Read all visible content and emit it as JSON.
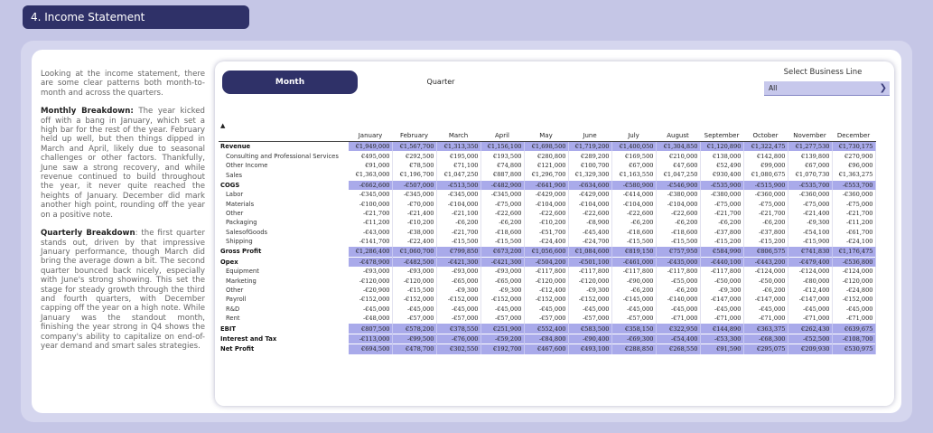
{
  "section_title": "4. Income Statement",
  "narrative": {
    "intro": "Looking at the income statement, there are some clear patterns both month-to-month and across the quarters.",
    "monthly_heading": "Monthly Breakdown:",
    "monthly_text": "The year kicked off with a bang in January, which set a high bar for the rest of the year. February held up well, but then things dipped in March and April, likely due to seasonal challenges or other factors. Thankfully, June saw a strong recovery, and while revenue continued to build throughout the year, it never quite reached the heights of January. December did mark another high point, rounding off the year on a positive note.",
    "quarterly_heading": "Quarterly Breakdown",
    "quarterly_text": ": the first quarter stands out, driven by that impressive January performance, though March did bring the average down a bit. The second quarter bounced back nicely, especially with June's strong showing. This set the stage for steady growth through the third and fourth quarters, with December capping off the year on a high note. While January was the standout month, finishing the year strong in Q4 shows the company's ability to capitalize on end-of-year demand and smart sales strategies."
  },
  "view_toggle": {
    "month_label": "Month",
    "quarter_label": "Quarter",
    "selected": "Month"
  },
  "business_line_filter": {
    "label": "Select Business Line",
    "value": "All"
  },
  "sort_indicator": "▲",
  "table": {
    "columns": [
      "January",
      "February",
      "March",
      "April",
      "May",
      "June",
      "July",
      "August",
      "September",
      "October",
      "November",
      "December"
    ],
    "rows": [
      {
        "label": "Revenue",
        "type": "group",
        "values": [
          "€1,949,000",
          "€1,567,700",
          "€1,313,350",
          "€1,156,100",
          "€1,698,500",
          "€1,719,200",
          "€1,400,050",
          "€1,304,850",
          "€1,120,890",
          "€1,322,475",
          "€1,277,530",
          "€1,730,175"
        ]
      },
      {
        "label": "Consulting and Professional Services",
        "type": "sub",
        "values": [
          "€495,000",
          "€292,500",
          "€195,000",
          "€193,500",
          "€280,800",
          "€289,200",
          "€169,500",
          "€210,000",
          "€138,000",
          "€142,800",
          "€139,800",
          "€270,900"
        ]
      },
      {
        "label": "Other Income",
        "type": "sub",
        "values": [
          "€91,000",
          "€78,500",
          "€71,100",
          "€74,800",
          "€121,000",
          "€100,700",
          "€67,000",
          "€47,600",
          "€52,490",
          "€99,000",
          "€67,000",
          "€96,000"
        ]
      },
      {
        "label": "Sales",
        "type": "sub",
        "values": [
          "€1,363,000",
          "€1,196,700",
          "€1,047,250",
          "€887,800",
          "€1,296,700",
          "€1,329,300",
          "€1,163,550",
          "€1,047,250",
          "€930,400",
          "€1,080,675",
          "€1,070,730",
          "€1,363,275"
        ]
      },
      {
        "label": "COGS",
        "type": "group",
        "values": [
          "-€662,600",
          "-€507,000",
          "-€513,500",
          "-€482,900",
          "-€641,900",
          "-€634,600",
          "-€580,900",
          "-€546,900",
          "-€535,900",
          "-€515,900",
          "-€535,700",
          "-€553,700"
        ]
      },
      {
        "label": "Labor",
        "type": "sub",
        "values": [
          "-€345,000",
          "-€345,000",
          "-€345,000",
          "-€345,000",
          "-€429,000",
          "-€429,000",
          "-€414,000",
          "-€380,000",
          "-€380,000",
          "-€360,000",
          "-€360,000",
          "-€360,000"
        ]
      },
      {
        "label": "Materials",
        "type": "sub",
        "values": [
          "-€100,000",
          "-€70,000",
          "-€104,000",
          "-€75,000",
          "-€104,000",
          "-€104,000",
          "-€104,000",
          "-€104,000",
          "-€75,000",
          "-€75,000",
          "-€75,000",
          "-€75,000"
        ]
      },
      {
        "label": "Other",
        "type": "sub",
        "values": [
          "-€21,700",
          "-€21,400",
          "-€21,100",
          "-€22,600",
          "-€22,600",
          "-€22,600",
          "-€22,600",
          "-€22,600",
          "-€21,700",
          "-€21,700",
          "-€21,400",
          "-€21,700"
        ]
      },
      {
        "label": "Packaging",
        "type": "sub",
        "values": [
          "-€11,200",
          "-€10,200",
          "-€6,200",
          "-€6,200",
          "-€10,200",
          "-€8,900",
          "-€6,200",
          "-€6,200",
          "-€6,200",
          "-€6,200",
          "-€9,300",
          "-€11,200"
        ]
      },
      {
        "label": "SalesofGoods",
        "type": "sub",
        "values": [
          "-€43,000",
          "-€38,000",
          "-€21,700",
          "-€18,600",
          "-€51,700",
          "-€45,400",
          "-€18,600",
          "-€18,600",
          "-€37,800",
          "-€37,800",
          "-€54,100",
          "-€61,700"
        ]
      },
      {
        "label": "Shipping",
        "type": "sub",
        "values": [
          "-€141,700",
          "-€22,400",
          "-€15,500",
          "-€15,500",
          "-€24,400",
          "-€24,700",
          "-€15,500",
          "-€15,500",
          "-€15,200",
          "-€15,200",
          "-€15,900",
          "-€24,100"
        ]
      },
      {
        "label": "Gross Profit",
        "type": "group",
        "values": [
          "€1,286,400",
          "€1,060,700",
          "€799,850",
          "€673,200",
          "€1,056,600",
          "€1,084,600",
          "€819,150",
          "€757,950",
          "€584,990",
          "€806,575",
          "€741,830",
          "€1,176,475"
        ]
      },
      {
        "label": "Opex",
        "type": "group",
        "values": [
          "-€478,900",
          "-€482,500",
          "-€421,300",
          "-€421,300",
          "-€504,200",
          "-€501,100",
          "-€461,000",
          "-€435,000",
          "-€440,100",
          "-€443,200",
          "-€479,400",
          "-€536,800"
        ]
      },
      {
        "label": "Equipment",
        "type": "sub",
        "values": [
          "-€93,000",
          "-€93,000",
          "-€93,000",
          "-€93,000",
          "-€117,800",
          "-€117,800",
          "-€117,800",
          "-€117,800",
          "-€117,800",
          "-€124,000",
          "-€124,000",
          "-€124,000"
        ]
      },
      {
        "label": "Marketing",
        "type": "sub",
        "values": [
          "-€120,000",
          "-€120,000",
          "-€65,000",
          "-€65,000",
          "-€120,000",
          "-€120,000",
          "-€90,000",
          "-€55,000",
          "-€50,000",
          "-€50,000",
          "-€80,000",
          "-€120,000"
        ]
      },
      {
        "label": "Other",
        "type": "sub",
        "values": [
          "-€20,900",
          "-€15,500",
          "-€9,300",
          "-€9,300",
          "-€12,400",
          "-€9,300",
          "-€6,200",
          "-€6,200",
          "-€9,300",
          "-€6,200",
          "-€12,400",
          "-€24,800"
        ]
      },
      {
        "label": "Payroll",
        "type": "sub",
        "values": [
          "-€152,000",
          "-€152,000",
          "-€152,000",
          "-€152,000",
          "-€152,000",
          "-€152,000",
          "-€145,000",
          "-€140,000",
          "-€147,000",
          "-€147,000",
          "-€147,000",
          "-€152,000"
        ]
      },
      {
        "label": "R&D",
        "type": "sub",
        "values": [
          "-€45,000",
          "-€45,000",
          "-€45,000",
          "-€45,000",
          "-€45,000",
          "-€45,000",
          "-€45,000",
          "-€45,000",
          "-€45,000",
          "-€45,000",
          "-€45,000",
          "-€45,000"
        ]
      },
      {
        "label": "Rent",
        "type": "sub",
        "values": [
          "-€48,000",
          "-€57,000",
          "-€57,000",
          "-€57,000",
          "-€57,000",
          "-€57,000",
          "-€57,000",
          "-€71,000",
          "-€71,000",
          "-€71,000",
          "-€71,000",
          "-€71,000"
        ]
      },
      {
        "label": "EBIT",
        "type": "group",
        "values": [
          "€807,500",
          "€578,200",
          "€378,550",
          "€251,900",
          "€552,400",
          "€583,500",
          "€358,150",
          "€322,950",
          "€144,890",
          "€363,375",
          "€262,430",
          "€639,675"
        ]
      },
      {
        "label": "Interest and Tax",
        "type": "group",
        "values": [
          "-€113,000",
          "-€99,500",
          "-€76,000",
          "-€59,200",
          "-€84,800",
          "-€90,400",
          "-€69,300",
          "-€54,400",
          "-€53,300",
          "-€68,300",
          "-€52,500",
          "-€108,700"
        ]
      },
      {
        "label": "Net Profit",
        "type": "group",
        "values": [
          "€694,500",
          "€478,700",
          "€302,550",
          "€192,700",
          "€467,600",
          "€493,100",
          "€288,850",
          "€268,550",
          "€91,590",
          "€295,075",
          "€209,930",
          "€530,975"
        ]
      }
    ]
  }
}
